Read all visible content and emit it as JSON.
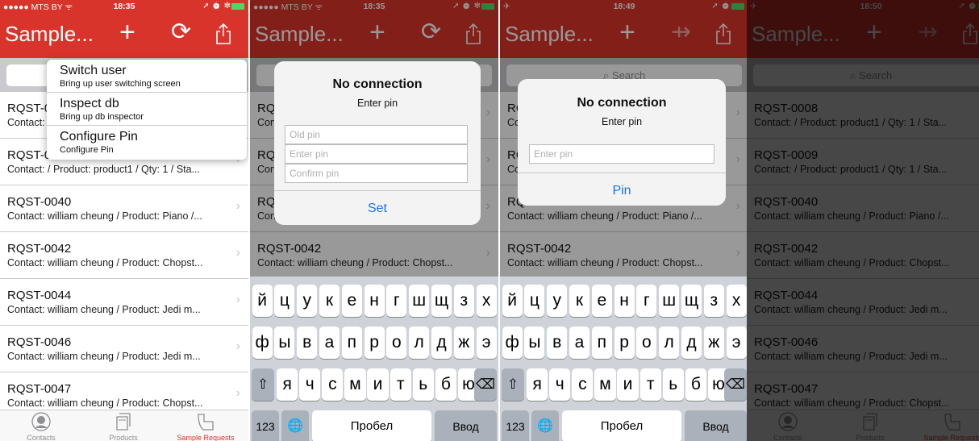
{
  "brand_color": "#d9342b",
  "status_bars": [
    {
      "carrier": "●●●●● MTS BY ᯤ",
      "time": "18:35",
      "indicators": "➚ ⏰ ✻"
    },
    {
      "carrier": "●●●●● MTS BY ᯤ",
      "time": "18:35",
      "indicators": "➚ ⏰ ✻"
    },
    {
      "carrier": "✈",
      "time": "18:49",
      "indicators": "➚ ⏰"
    },
    {
      "carrier": "✈",
      "time": "18:50",
      "indicators": "➚ ⏰"
    }
  ],
  "nav": {
    "title": "Sample...",
    "add_icon": "plus-icon",
    "sync_icon": "sync-icon",
    "share_icon": "share-icon",
    "plus_glyph": "+",
    "sync_glyph": "⟳",
    "no_sync_glyph": "⇸"
  },
  "search": {
    "placeholder": "Search",
    "glyph": "⌕"
  },
  "rows": [
    {
      "title": "RQST-0008",
      "subtitle": "Contact:  / Product: product1 / Qty: 1 / Sta..."
    },
    {
      "title": "RQST-0009",
      "subtitle": "Contact:  / Product: product1 / Qty: 1 / Sta..."
    },
    {
      "title": "RQST-0040",
      "subtitle": "Contact: william cheung / Product: Piano /..."
    },
    {
      "title": "RQST-0042",
      "subtitle": "Contact: william cheung / Product: Chopst..."
    },
    {
      "title": "RQST-0044",
      "subtitle": "Contact: william cheung / Product: Jedi m..."
    },
    {
      "title": "RQST-0046",
      "subtitle": "Contact: william cheung / Product: Jedi m..."
    },
    {
      "title": "RQST-0047",
      "subtitle": "Contact: william cheung / Product: Chopst..."
    }
  ],
  "chevron": "›",
  "tabs": [
    {
      "label": "Contacts",
      "icon": "contacts-icon"
    },
    {
      "label": "Products",
      "icon": "products-icon"
    },
    {
      "label": "Sample Requests",
      "icon": "sample-requests-icon"
    }
  ],
  "popup_menu": [
    {
      "title": "Switch user",
      "subtitle": "Bring up user switching screen"
    },
    {
      "title": "Inspect db",
      "subtitle": "Bring up db inspector"
    },
    {
      "title": "Configure Pin",
      "subtitle": "Configure Pin"
    }
  ],
  "dialog_set_pin": {
    "title": "No connection",
    "message": "Enter pin",
    "old_pin_placeholder": "Old pin",
    "enter_pin_placeholder": "Enter pin",
    "confirm_pin_placeholder": "Confirm pin",
    "button": "Set"
  },
  "dialog_pin": {
    "title": "No connection",
    "message": "Enter pin",
    "pin_placeholder": "Enter pin",
    "button": "Pin"
  },
  "keyboard": {
    "row1": [
      "й",
      "ц",
      "у",
      "к",
      "е",
      "н",
      "г",
      "ш",
      "щ",
      "з",
      "х"
    ],
    "row2": [
      "ф",
      "ы",
      "в",
      "а",
      "п",
      "р",
      "о",
      "л",
      "д",
      "ж",
      "э"
    ],
    "row3": [
      "я",
      "ч",
      "с",
      "м",
      "и",
      "т",
      "ь",
      "б",
      "ю"
    ],
    "shift_glyph": "⇧",
    "delete_glyph": "⌫",
    "numbers_label": "123",
    "globe_glyph": "🌐",
    "space_label": "Пробел",
    "return_label": "Ввод"
  }
}
